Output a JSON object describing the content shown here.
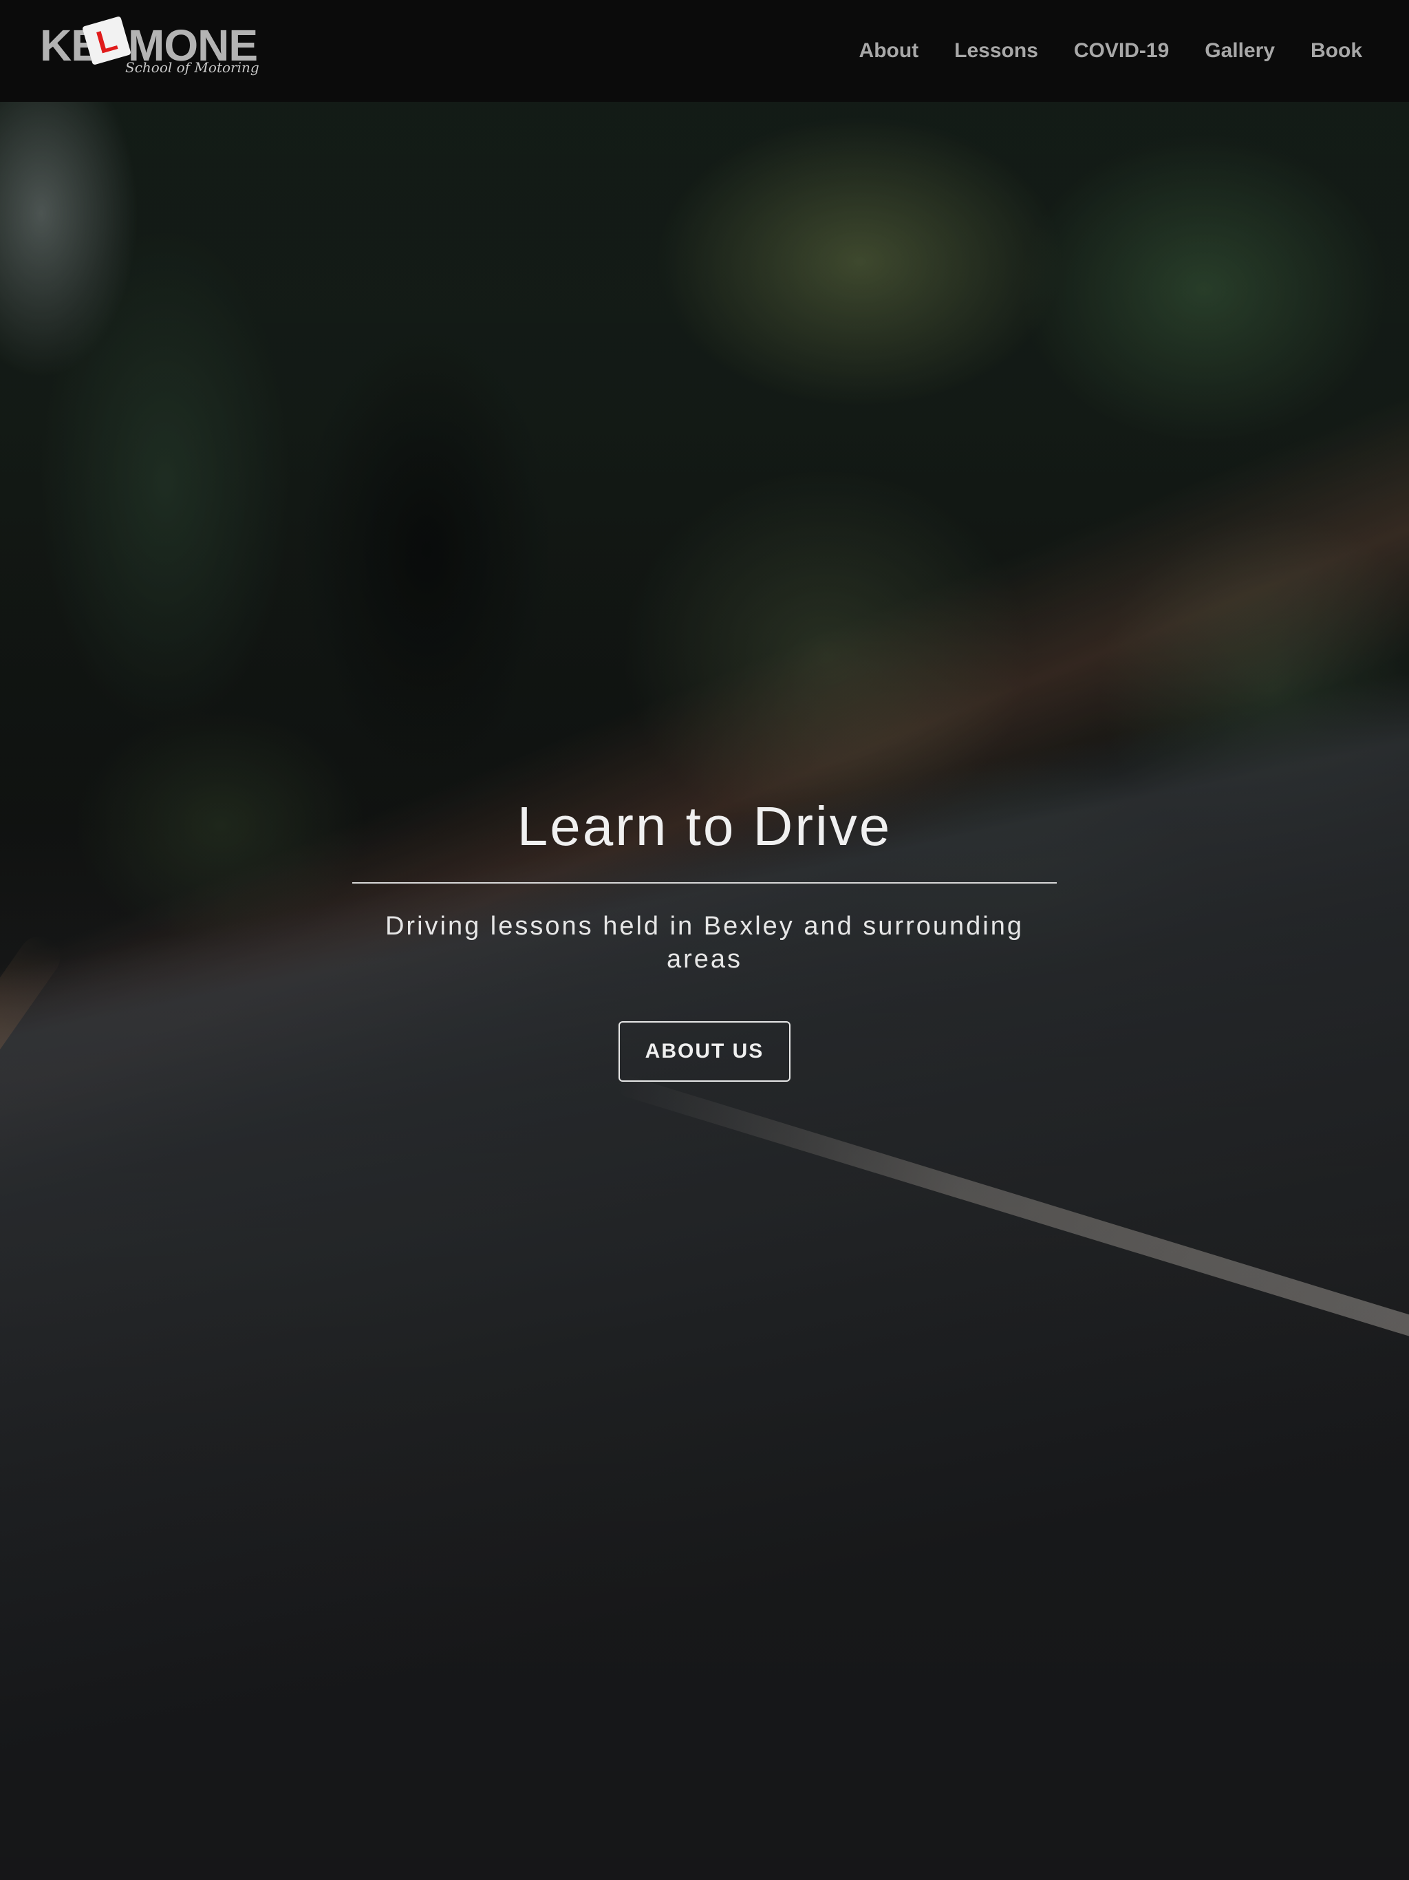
{
  "header": {
    "logo": {
      "text_left": "KE",
      "plate_letter": "L",
      "text_right": "MONE",
      "tagline": "School of Motoring"
    },
    "nav": [
      {
        "label": "About"
      },
      {
        "label": "Lessons"
      },
      {
        "label": "COVID-19"
      },
      {
        "label": "Gallery"
      },
      {
        "label": "Book"
      }
    ]
  },
  "hero": {
    "title": "Learn to Drive",
    "subtitle": "Driving lessons held in Bexley and surrounding areas",
    "button_label": "ABOUT US",
    "background_image": "blurred-forest-road"
  },
  "colors": {
    "navbar_bg": "#0b0b0b",
    "nav_text": "#a8a8a8",
    "logo_text": "#b3b3b3",
    "plate_red": "#e01b1b",
    "hero_text": "#f0f0f0"
  }
}
